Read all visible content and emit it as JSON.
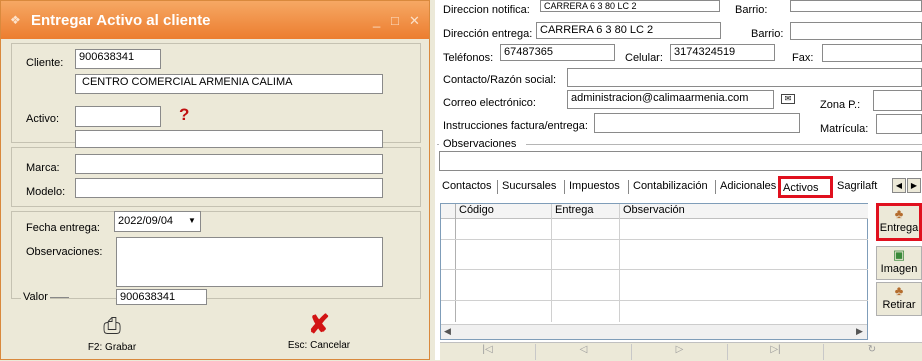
{
  "dialog": {
    "title": "Entregar Activo al cliente",
    "minimize_glyph": "_",
    "maximize_glyph": "□",
    "close_glyph": "✕",
    "cliente_label": "Cliente:",
    "cliente_code": "900638341",
    "cliente_name": "CENTRO COMERCIAL ARMENIA CALIMA",
    "activo_label": "Activo:",
    "activo_value": "",
    "activo_help": "?",
    "activo_desc": "",
    "marca_label": "Marca:",
    "marca_value": "",
    "modelo_label": "Modelo:",
    "modelo_value": "",
    "fecha_label": "Fecha entrega:",
    "fecha_value": "2022/09/04",
    "observaciones_label": "Observaciones:",
    "observaciones_value": "",
    "valor_label": "Valor",
    "valor_value": "900638341",
    "save_label": "F2: Grabar",
    "cancel_label": "Esc: Cancelar"
  },
  "background": {
    "direccion_notifica_label": "Direccion notifica:",
    "direccion_notifica_value": "CARRERA 6 3 80 LC 2",
    "barrio_label": "Barrio:",
    "direccion_entrega_label": "Dirección entrega:",
    "direccion_entrega_value": "CARRERA 6 3 80 LC 2",
    "telefonos_label": "Teléfonos:",
    "telefonos_value": "67487365",
    "celular_label": "Celular:",
    "celular_value": "3174324519",
    "fax_label": "Fax:",
    "contacto_label": "Contacto/Razón social:",
    "correo_label": "Correo electrónico:",
    "correo_value": "administracion@calimaarmenia.com",
    "zona_label": "Zona P.:",
    "instrucciones_label": "Instrucciones factura/entrega:",
    "matricula_label": "Matrícula:",
    "observaciones_label": "Observaciones",
    "tabs": [
      "Contactos",
      "Sucursales",
      "Impuestos",
      "Contabilización",
      "Adicionales",
      "Activos",
      "Sagrilaft"
    ],
    "grid_headers": [
      "Código",
      "Entrega",
      "Observación"
    ],
    "side_buttons": [
      "Entrega",
      "Imagen",
      "Retirar"
    ],
    "scroll_left": "◀",
    "scroll_right": "▶"
  },
  "colors": {
    "title_gradient_top": "#f6a864",
    "title_gradient_bottom": "#ec7d2f",
    "highlight_red": "#e0101e"
  }
}
